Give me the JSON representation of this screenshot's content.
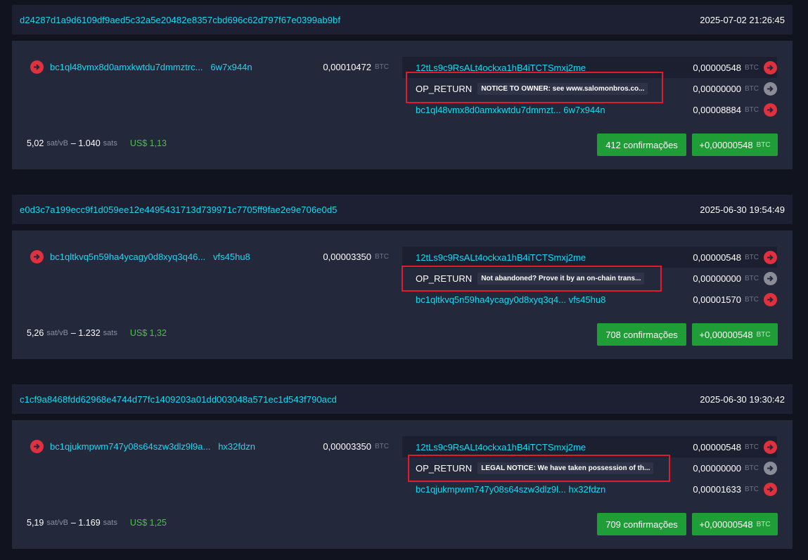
{
  "colors": {
    "background": "#11131f",
    "header": "#1d2032",
    "body": "#24283b",
    "accent_link": "#1bd8f0",
    "arrow_red": "#e0313e",
    "arrow_grey": "#8a8d98",
    "confirm_green": "#1f9d37",
    "usd_green": "#4cc04a",
    "highlight_box": "#e21b2c"
  },
  "unit": "BTC",
  "fee_rate_unit": "sat/vB",
  "fee_size_unit": "sats",
  "transactions": [
    {
      "txid": "d24287d1a9d6109df9aed5c32a5e20482e8357cbd696c62d797f67e0399ab9bf",
      "time": "2025-07-02 21:26:45",
      "input": {
        "addr": "bc1ql48vmx8d0amxkwtdu7dmmztrc...",
        "addr_end": "6w7x944n",
        "amount": "0,00010472"
      },
      "outputs": [
        {
          "addr": "12tLs9c9RsALt4ockxa1hB4iTCTSmxj2me",
          "amount": "0,00000548",
          "icon": "arrow-right-icon"
        },
        {
          "label": "OP_RETURN",
          "message": "NOTICE TO OWNER: see www.salomonbros.co...",
          "amount": "0,00000000",
          "icon": "arrow-right-icon"
        },
        {
          "addr": "bc1ql48vmx8d0amxkwtdu7dmmzt...",
          "addr_end": "6w7x944n",
          "amount": "0,00008884",
          "icon": "arrow-right-icon"
        }
      ],
      "fee_rate": "5,02",
      "fee_sats": "1.040",
      "usd": "US$ 1,13",
      "confirmations": "412 confirmações",
      "net": "+0,00000548"
    },
    {
      "txid": "e0d3c7a199ecc9f1d059ee12e4495431713d739971c7705ff9fae2e9e706e0d5",
      "time": "2025-06-30 19:54:49",
      "input": {
        "addr": "bc1qltkvq5n59ha4ycagy0d8xyq3q46...",
        "addr_end": "vfs45hu8",
        "amount": "0,00003350"
      },
      "outputs": [
        {
          "addr": "12tLs9c9RsALt4ockxa1hB4iTCTSmxj2me",
          "amount": "0,00000548",
          "icon": "arrow-right-icon"
        },
        {
          "label": "OP_RETURN",
          "message": "Not abandoned? Prove it by an on-chain trans...",
          "amount": "0,00000000",
          "icon": "arrow-right-icon"
        },
        {
          "addr": "bc1qltkvq5n59ha4ycagy0d8xyq3q4...",
          "addr_end": "vfs45hu8",
          "amount": "0,00001570",
          "icon": "arrow-right-icon"
        }
      ],
      "fee_rate": "5,26",
      "fee_sats": "1.232",
      "usd": "US$ 1,32",
      "confirmations": "708 confirmações",
      "net": "+0,00000548"
    },
    {
      "txid": "c1cf9a8468fdd62968e4744d77fc1409203a01dd003048a571ec1d543f790acd",
      "time": "2025-06-30 19:30:42",
      "input": {
        "addr": "bc1qjukmpwm747y08s64szw3dlz9l9a...",
        "addr_end": "hx32fdzn",
        "amount": "0,00003350"
      },
      "outputs": [
        {
          "addr": "12tLs9c9RsALt4ockxa1hB4iTCTSmxj2me",
          "amount": "0,00000548",
          "icon": "arrow-right-icon"
        },
        {
          "label": "OP_RETURN",
          "message": "LEGAL NOTICE: We have taken possession of th...",
          "amount": "0,00000000",
          "icon": "arrow-right-icon"
        },
        {
          "addr": "bc1qjukmpwm747y08s64szw3dlz9l...",
          "addr_end": "hx32fdzn",
          "amount": "0,00001633",
          "icon": "arrow-right-icon"
        }
      ],
      "fee_rate": "5,19",
      "fee_sats": "1.169",
      "usd": "US$ 1,25",
      "confirmations": "709 confirmações",
      "net": "+0,00000548"
    }
  ]
}
